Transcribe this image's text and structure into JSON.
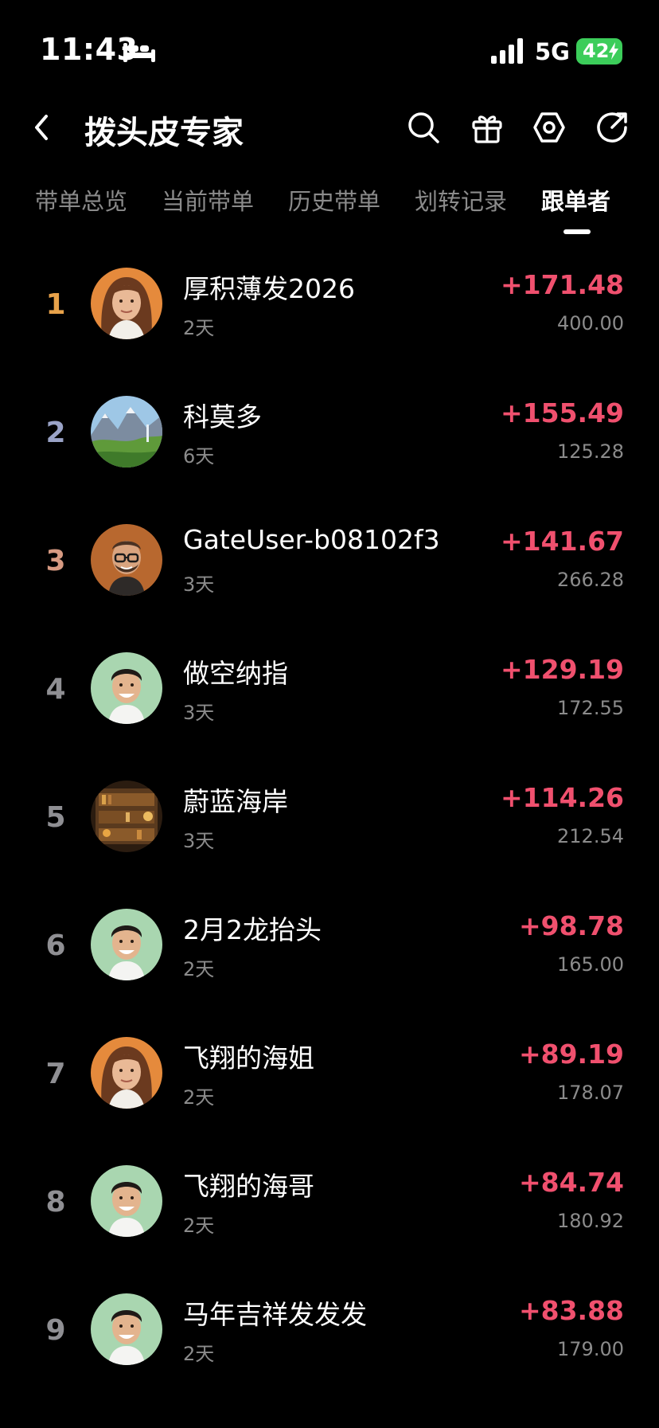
{
  "status_bar": {
    "time": "11:43",
    "network": "5G",
    "battery": "42",
    "icons": [
      "bed-icon",
      "signal-icon",
      "battery-icon"
    ]
  },
  "header": {
    "title": "拨头皮专家",
    "icons": [
      "back-icon",
      "search-icon",
      "gift-icon",
      "settings-icon",
      "share-icon"
    ]
  },
  "tabs": [
    {
      "label": "带单总览",
      "active": false
    },
    {
      "label": "当前带单",
      "active": false
    },
    {
      "label": "历史带单",
      "active": false
    },
    {
      "label": "划转记录",
      "active": false
    },
    {
      "label": "跟单者",
      "active": true
    }
  ],
  "colors": {
    "background": "#000000",
    "profit": "#f0506e",
    "rank_gold": "#e8a24a",
    "rank_silver": "#9aa3c7",
    "rank_bronze": "#d79a82",
    "rank_default": "#8f8f93",
    "muted_text": "#8b8b8b",
    "battery": "#3ccd5a"
  },
  "followers": [
    {
      "rank": "1",
      "name": "厚积薄发2026",
      "days": "2天",
      "pnl": "+171.48",
      "amount": "400.00",
      "avatar": "woman-avatar"
    },
    {
      "rank": "2",
      "name": "科莫多",
      "days": "6天",
      "pnl": "+155.49",
      "amount": "125.28",
      "avatar": "landscape-avatar"
    },
    {
      "rank": "3",
      "name": "GateUser-b08102f3",
      "days": "3天",
      "pnl": "+141.67",
      "amount": "266.28",
      "avatar": "glasses-man-avatar"
    },
    {
      "rank": "4",
      "name": "做空纳指",
      "days": "3天",
      "pnl": "+129.19",
      "amount": "172.55",
      "avatar": "smiling-man-avatar"
    },
    {
      "rank": "5",
      "name": "蔚蓝海岸",
      "days": "3天",
      "pnl": "+114.26",
      "amount": "212.54",
      "avatar": "bookshelf-avatar"
    },
    {
      "rank": "6",
      "name": "2月2龙抬头",
      "days": "2天",
      "pnl": "+98.78",
      "amount": "165.00",
      "avatar": "smiling-man-avatar"
    },
    {
      "rank": "7",
      "name": "飞翔的海姐",
      "days": "2天",
      "pnl": "+89.19",
      "amount": "178.07",
      "avatar": "woman-avatar"
    },
    {
      "rank": "8",
      "name": "飞翔的海哥",
      "days": "2天",
      "pnl": "+84.74",
      "amount": "180.92",
      "avatar": "smiling-man-avatar"
    },
    {
      "rank": "9",
      "name": "马年吉祥发发发",
      "days": "2天",
      "pnl": "+83.88",
      "amount": "179.00",
      "avatar": "smiling-man-avatar"
    }
  ]
}
